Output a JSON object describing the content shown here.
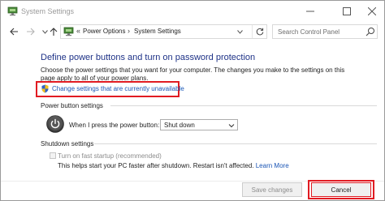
{
  "window": {
    "title": "System Settings",
    "controls": {
      "minimize": "—",
      "maximize": "☐",
      "close": "✕"
    }
  },
  "nav": {
    "back_icon": "arrow-left-icon",
    "forward_icon": "arrow-right-icon",
    "recent_icon": "chevron-down-icon",
    "up_icon": "arrow-up-icon",
    "address": {
      "separator": "«",
      "crumbs": [
        "Power Options",
        "System Settings"
      ],
      "crumb_separator": "›"
    },
    "search_placeholder": "Search Control Panel"
  },
  "content": {
    "heading": "Define power buttons and turn on password protection",
    "description": "Choose the power settings that you want for your computer. The changes you make to the settings on this page apply to all of your power plans.",
    "change_link": "Change settings that are currently unavailable",
    "power_section": {
      "label": "Power button settings",
      "row_label": "When I press the power button:",
      "selected": "Shut down"
    },
    "shutdown_section": {
      "label": "Shutdown settings",
      "fast_startup_label": "Turn on fast startup (recommended)",
      "fast_startup_desc": "This helps start your PC faster after shutdown. Restart isn't affected.",
      "learn_more": "Learn More"
    }
  },
  "footer": {
    "save_label": "Save changes",
    "cancel_label": "Cancel"
  },
  "colors": {
    "heading": "#1e3287",
    "link": "#1a55b5",
    "highlight": "#e11b22"
  }
}
